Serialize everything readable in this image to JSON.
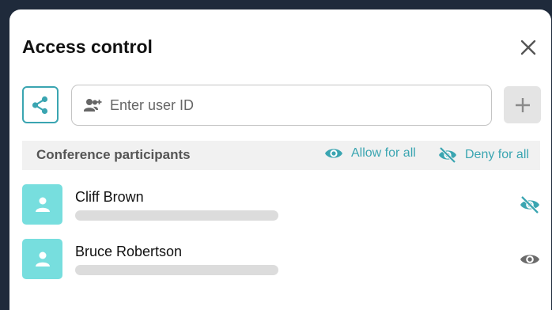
{
  "dialog": {
    "title": "Access control"
  },
  "search": {
    "placeholder": "Enter user ID",
    "value": ""
  },
  "section": {
    "title": "Conference participants",
    "allow_label": "Allow for all",
    "deny_label": "Deny for all"
  },
  "participants": [
    {
      "name": "Cliff Brown",
      "visibility": "hidden"
    },
    {
      "name": "Bruce Robertson",
      "visibility": "visible"
    }
  ],
  "icons": {
    "close": "close-icon",
    "share": "share-icon",
    "add_user": "add-user-icon",
    "plus": "plus-icon",
    "eye": "eye-icon",
    "eye_off": "eye-off-icon",
    "person": "person-icon"
  },
  "colors": {
    "accent": "#3aa5b1",
    "avatar": "#77dede",
    "backdrop": "#1f2a3b"
  }
}
